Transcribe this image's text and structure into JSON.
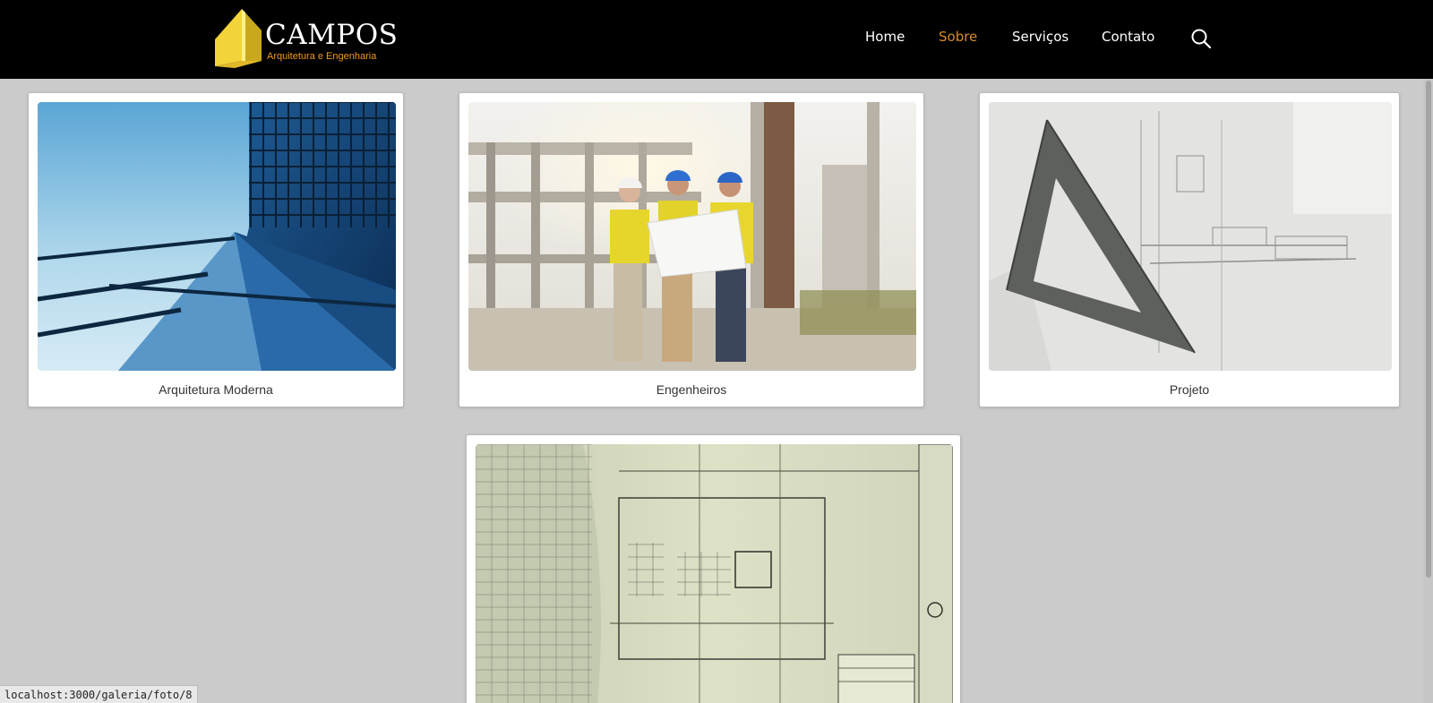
{
  "brand": {
    "name": "CAMPOS",
    "tagline": "Arquitetura e Engenharia",
    "accent_color": "#f29a1c",
    "logo_color": "#f2d43a"
  },
  "nav": {
    "items": [
      {
        "label": "Home",
        "active": false
      },
      {
        "label": "Sobre",
        "active": true
      },
      {
        "label": "Serviços",
        "active": false
      },
      {
        "label": "Contato",
        "active": false
      }
    ],
    "search_icon": "search-icon",
    "active_color": "#d9892b"
  },
  "gallery": {
    "items": [
      {
        "caption": "Arquitetura Moderna",
        "image": "modern-glass-building-photo"
      },
      {
        "caption": "Engenheiros",
        "image": "engineers-with-blueprint-photo"
      },
      {
        "caption": "Projeto",
        "image": "triangle-ruler-on-blueprint-photo"
      },
      {
        "caption": "",
        "image": "architectural-blueprints-photo"
      }
    ]
  },
  "status_bar": {
    "url": "localhost:3000/galeria/foto/8"
  }
}
